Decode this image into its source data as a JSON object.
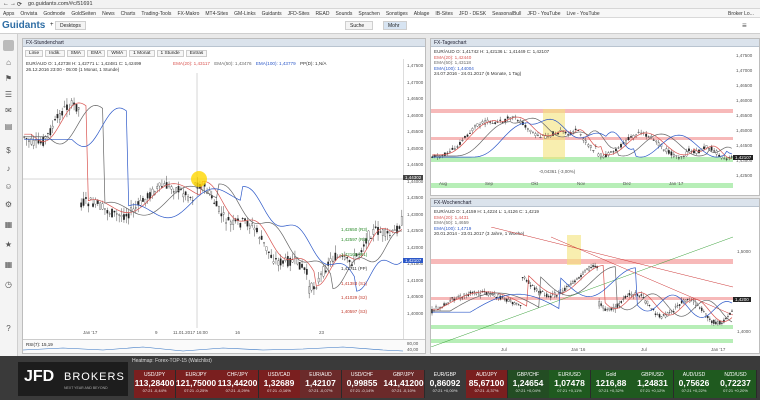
{
  "browser": {
    "url": "go.guidants.com/#c/51691",
    "bookmarks": [
      "Apps",
      "Onvista",
      "Godmode",
      "GoldSeiten",
      "News",
      "Charts",
      "Trading-Tools",
      "FX-Makro",
      "MT4-Sites",
      "GM-Links",
      "Guidants",
      "JFD-Sites",
      "READ",
      "Sounds",
      "Sprachen",
      "Sonstiges",
      "Ablage",
      "IB-Sites",
      "JFD - DESK",
      "SeasonalBull",
      "JFD - YouTube",
      "Live - YouTube"
    ],
    "right_label": "Broker Lo..."
  },
  "app": {
    "logo": "Guidants",
    "tabs": [
      "Desktops"
    ],
    "tab_x": "×",
    "search": "Suche",
    "button": "Mohr"
  },
  "main_chart": {
    "title": "FX-Stundenchart",
    "toolbar": [
      "Linie",
      "Indik.",
      "SMA",
      "EMA",
      "WMA",
      "1 Monat",
      "1 Stunde",
      "Extras"
    ],
    "legend": [
      "EUR/AUD  O: 1,42738  H: 1,42771  L: 1,42481  C: 1,42499",
      "EMA(20): 1,43117",
      "EMA(50): 1,43476",
      "EMA(100): 1,43779",
      "PP(D): 1,N/A",
      "26.12.2016 23:00 - 05:00  (1 Monat, 1 Stunde)"
    ],
    "y_ticks": [
      "1,47500",
      "1,47000",
      "1,46500",
      "1,46000",
      "1,45500",
      "1,45000",
      "1,44500",
      "1,44000",
      "1,43500",
      "1,43000",
      "1,42500",
      "1,42000",
      "1,41500",
      "1,41000",
      "1,40500",
      "1,40000"
    ],
    "pivot_levels": [
      {
        "label": "1,42650 (R3)",
        "color": "#2a8a2a"
      },
      {
        "label": "1,42597 (R2)",
        "color": "#2a8a2a"
      },
      {
        "label": "1,42169 (R1)",
        "color": "#2a8a2a"
      },
      {
        "label": "1,41711 (PP)",
        "color": "#333333"
      },
      {
        "label": "1,41383 (S1)",
        "color": "#c0392b"
      },
      {
        "label": "1,41029 (S2)",
        "color": "#c0392b"
      },
      {
        "label": "1,40597 (S3)",
        "color": "#c0392b"
      }
    ],
    "crosshair_price": "1,44302",
    "last_price": "1,42107",
    "x_ticks": [
      "Jan '17",
      "9",
      "11.01.2017 16:00",
      "16",
      "23"
    ],
    "rsi_label": "RSI(7): 15,19",
    "rsi_ticks": [
      "80,00",
      "40,00",
      "20,00"
    ]
  },
  "daily_chart": {
    "title": "FX-Tageschart",
    "legend": [
      "EUR/AUD  O: 1,41742  H: 1,42136  L: 1,41449  C: 1,42107",
      "EMA(20): 1,42440",
      "EMA(50): 1,43118",
      "EMA(100): 1,44004",
      "24.07.2016 - 24.01.2017  (6 Monate, 1 Tag)"
    ],
    "annotation": "-0,04361 (-3,00%)",
    "y_ticks": [
      "1,47500",
      "1,47000",
      "1,46500",
      "1,46000",
      "1,45500",
      "1,45000",
      "1,44500",
      "1,43500",
      "1,42500"
    ],
    "last_price": "1,42107",
    "x_ticks": [
      "Aug",
      "Sep",
      "Okt",
      "Nov",
      "Dez",
      "Jan '17"
    ]
  },
  "weekly_chart": {
    "title": "FX-Wochenchart",
    "legend": [
      "EUR/AUD  O: 1,4159  H: 1,4224  L: 1,4126  C: 1,4219",
      "EMA(20): 1,4431",
      "EMA(50): 1,4659",
      "EMA(100): 1,4719",
      "20.01.2014 - 23.01.2017  (3 Jahre, 1 Woche)"
    ],
    "y_ticks": [
      "1,5000",
      "1,4000"
    ],
    "last_price": "1,4200",
    "x_ticks": [
      "Jul",
      "Jan '16",
      "Jul",
      "Jan '17"
    ]
  },
  "heatmap": {
    "title": "Heatmap: Forex-TOP-15 (Watchlist)",
    "logo_main": "JFD",
    "logo_sub": "BROKERS",
    "logo_tag": "NEXT YEAR AND BEYOND",
    "items": [
      {
        "sym": "USD/JPY",
        "val": "113,28400",
        "chg": "07:21 -0,44%",
        "color": "#7a1f1f"
      },
      {
        "sym": "EUR/JPY",
        "val": "121,75000",
        "chg": "07:21 -0,25%",
        "color": "#7a1f1f"
      },
      {
        "sym": "CHF/JPY",
        "val": "113,44200",
        "chg": "07:21 -0,29%",
        "color": "#7a1f1f"
      },
      {
        "sym": "USD/CAD",
        "val": "1,32689",
        "chg": "07:21 -0,16%",
        "color": "#7a1f1f"
      },
      {
        "sym": "EUR/AUD",
        "val": "1,42107",
        "chg": "07:21 -0,07%",
        "color": "#6b2a2a"
      },
      {
        "sym": "USD/CHF",
        "val": "0,99855",
        "chg": "07:21 -0,14%",
        "color": "#6b2a2a"
      },
      {
        "sym": "GBP/JPY",
        "val": "141,41200",
        "chg": "07:21 -0,10%",
        "color": "#6b2a2a"
      },
      {
        "sym": "EUR/GBP",
        "val": "0,86092",
        "chg": "07:21 +0,00%",
        "color": "#3a3a3a"
      },
      {
        "sym": "AUD/JPY",
        "val": "85,67100",
        "chg": "07:21 -0,37%",
        "color": "#7a1f1f"
      },
      {
        "sym": "GBP/CHF",
        "val": "1,24654",
        "chg": "07:21 +0,04%",
        "color": "#234d23"
      },
      {
        "sym": "EUR/USD",
        "val": "1,07478",
        "chg": "07:21 +0,11%",
        "color": "#1f5a1f"
      },
      {
        "sym": "Gold",
        "val": "1216,88",
        "chg": "07:21 +0,32%",
        "color": "#1f5a1f"
      },
      {
        "sym": "GBP/USD",
        "val": "1,24831",
        "chg": "07:21 +0,12%",
        "color": "#1f5a1f"
      },
      {
        "sym": "AUD/USD",
        "val": "0,75626",
        "chg": "07:21 +0,22%",
        "color": "#1f5a1f"
      },
      {
        "sym": "NZD/USD",
        "val": "0,72237",
        "chg": "07:21 +0,20%",
        "color": "#1f5a1f"
      }
    ]
  },
  "colors": {
    "ema20": "#d9534f",
    "ema50": "#666666",
    "ema100": "#2c58c8",
    "candle": "#222222",
    "support_band": "#7be07b",
    "resistance_band": "#f08080",
    "highlight": "#f3e27a"
  }
}
